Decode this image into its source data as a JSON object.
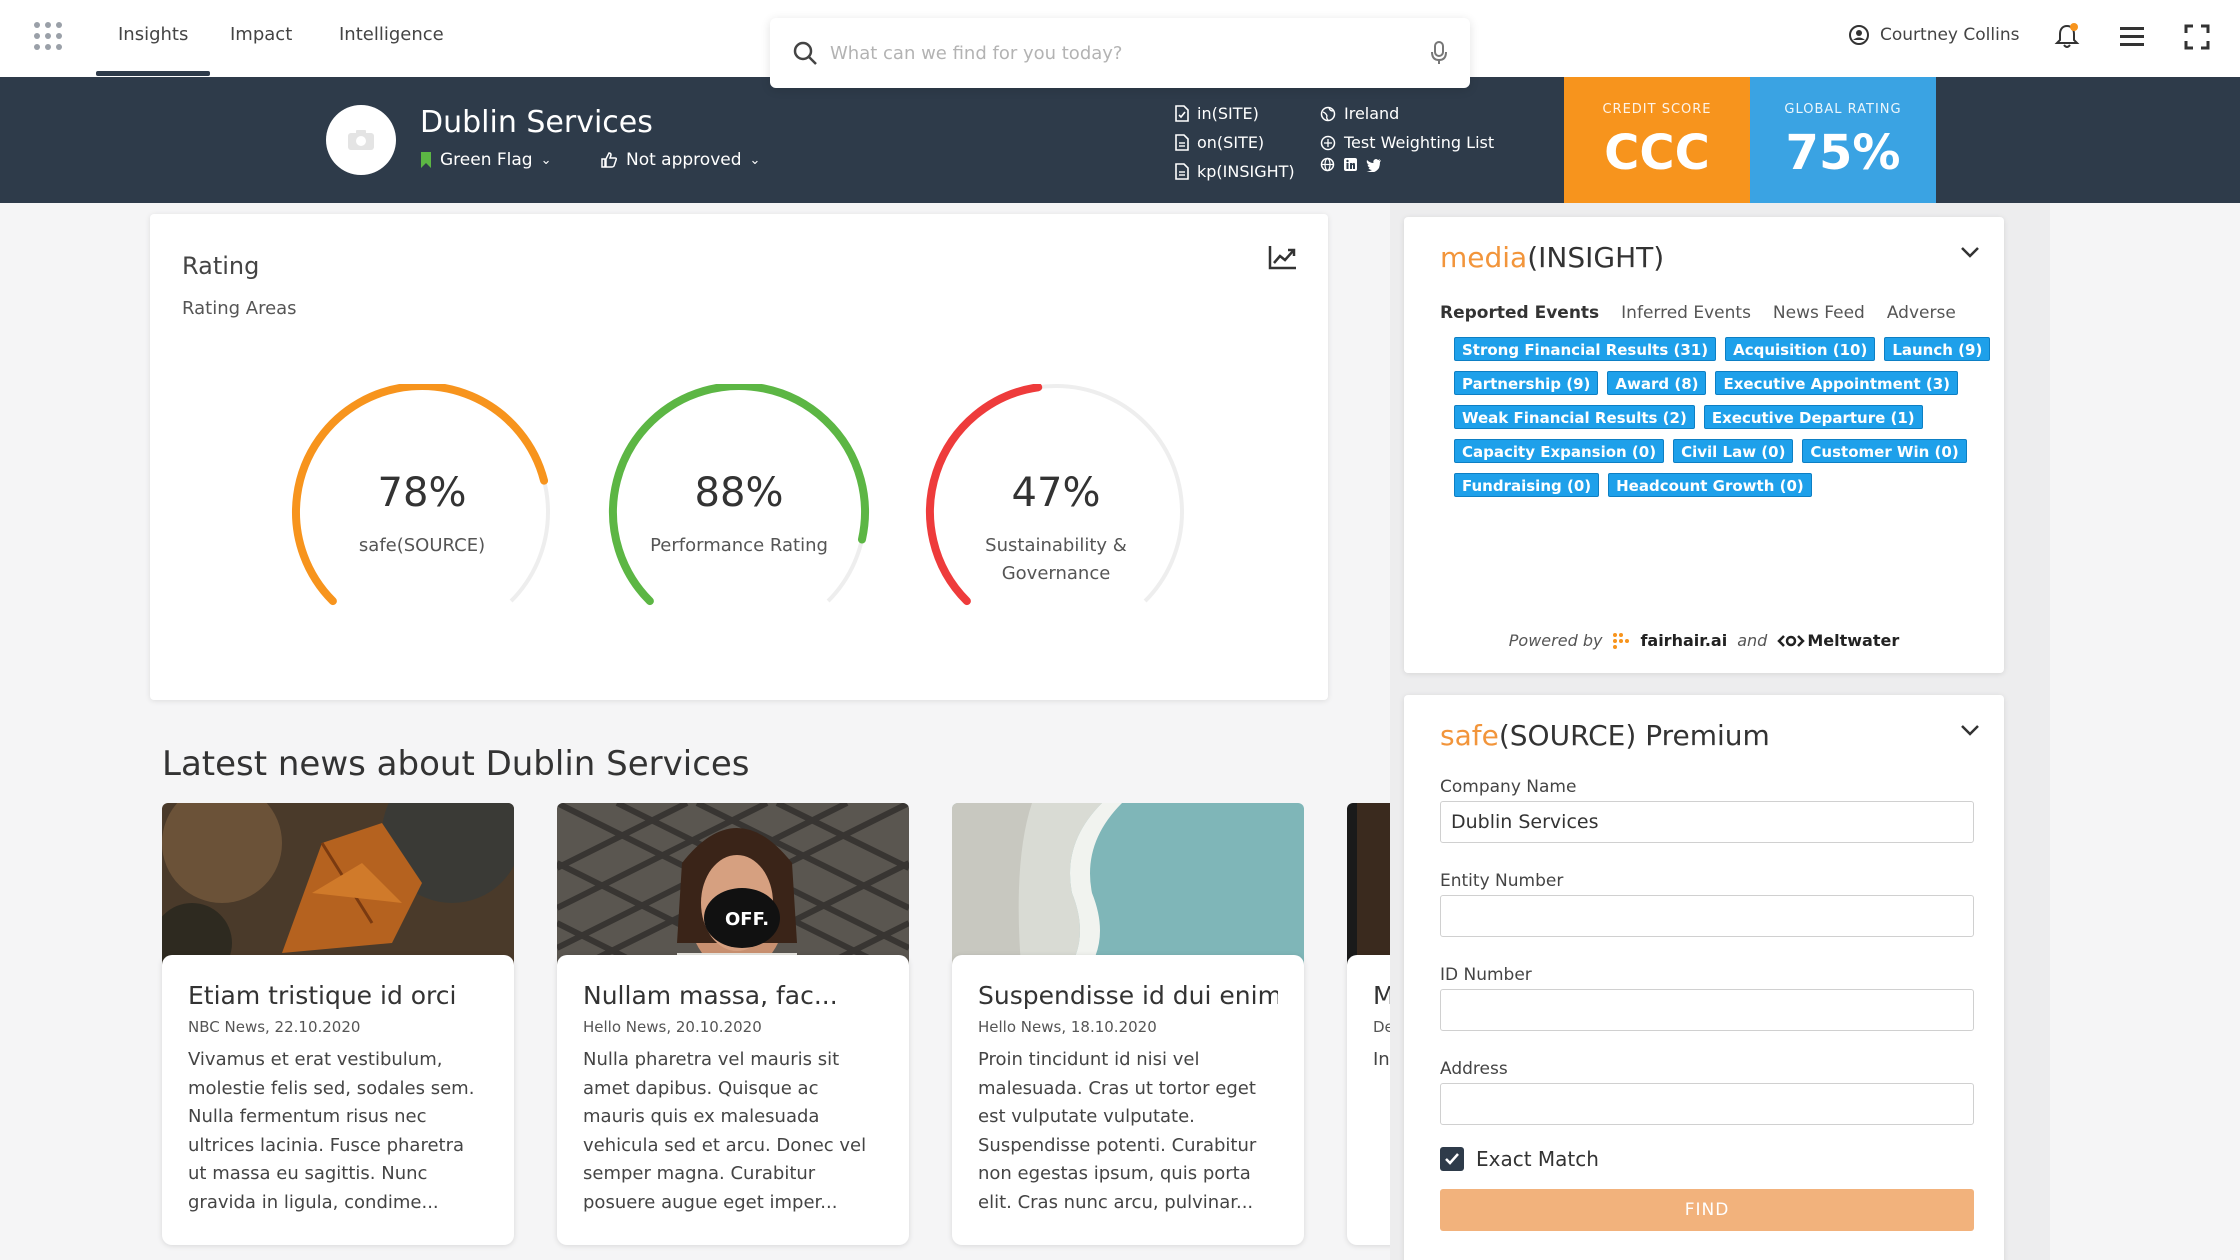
{
  "nav": {
    "tabs": [
      {
        "label": "Insights",
        "active": true
      },
      {
        "label": "Impact",
        "active": false
      },
      {
        "label": "Intelligence",
        "active": false
      }
    ],
    "search_placeholder": "What can we find for you today?",
    "user_name": "Courtney Collins"
  },
  "company": {
    "name": "Dublin Services",
    "flag_label": "Green Flag",
    "approval_label": "Not approved",
    "links": [
      "in(SITE)",
      "on(SITE)",
      "kp(INSIGHT)"
    ],
    "country": "Ireland",
    "weighting_list": "Test Weighting List",
    "credit_score": {
      "label": "CREDIT SCORE",
      "value": "CCC",
      "color": "#f7941d"
    },
    "global_rating": {
      "label": "GLOBAL RATING",
      "value": "75%",
      "color": "#3aa3e3"
    }
  },
  "rating": {
    "title": "Rating",
    "subtitle": "Rating Areas",
    "gauges": [
      {
        "value": 78,
        "display": "78%",
        "label": "safe(SOURCE)",
        "color": "#f7941d"
      },
      {
        "value": 88,
        "display": "88%",
        "label": "Performance Rating",
        "color": "#5cb644"
      },
      {
        "value": 47,
        "display": "47%",
        "label": "Sustainability & Governance",
        "color": "#ee3b3b"
      }
    ]
  },
  "news": {
    "heading": "Latest news about Dublin Services",
    "items": [
      {
        "title": "Etiam tristique id orci",
        "meta": "NBC News, 22.10.2020",
        "text": "Vivamus et erat vestibulum, molestie felis sed, sodales sem. Nulla fermentum risus nec ultrices lacinia. Fusce pharetra ut massa eu sagittis. Nunc gravida in ligula, condime..."
      },
      {
        "title": "Nullam massa, fac...",
        "meta": "Hello News, 20.10.2020",
        "text": "Nulla pharetra vel mauris sit amet dapibus. Quisque ac mauris quis ex malesuada vehicula sed et arcu. Donec vel semper magna. Curabitur posuere augue eget imper..."
      },
      {
        "title": "Suspendisse id dui enim",
        "meta": "Hello News, 18.10.2020",
        "text": "Proin tincidunt id nisi vel malesuada. Cras ut tortor eget est vulputate vulputate. Suspendisse potenti. Curabitur non egestas ipsum, quis porta elit. Cras nunc arcu, pulvinar..."
      },
      {
        "title": "M",
        "meta": "De",
        "text": "In c n m"
      }
    ]
  },
  "media": {
    "title_accent": "media",
    "title_rest": "(INSIGHT)",
    "tabs": [
      "Reported Events",
      "Inferred Events",
      "News Feed",
      "Adverse"
    ],
    "tag_rows": [
      [
        "Strong Financial Results (31)",
        "Acquisition (10)",
        "Launch (9)"
      ],
      [
        "Partnership (9)",
        "Award (8)",
        "Executive Appointment (3)"
      ],
      [
        "Weak Financial Results (2)",
        "Executive Departure (1)"
      ],
      [
        "Capacity Expansion (0)",
        "Civil Law (0)",
        "Customer Win (0)"
      ],
      [
        "Fundraising (0)",
        "Headcount Growth (0)"
      ]
    ],
    "powered_by": "Powered by",
    "partner_1": "fairhair.ai",
    "and_text": "and",
    "partner_2": "Meltwater"
  },
  "safesource": {
    "title_accent": "safe",
    "title_rest": "(SOURCE) Premium",
    "company_name_label": "Company Name",
    "company_name_value": "Dublin Services",
    "entity_label": "Entity Number",
    "entity_value": "",
    "id_label": "ID Number",
    "id_value": "",
    "address_label": "Address",
    "address_value": "",
    "exact_match_label": "Exact Match",
    "exact_match_checked": true,
    "find_label": "FIND"
  }
}
